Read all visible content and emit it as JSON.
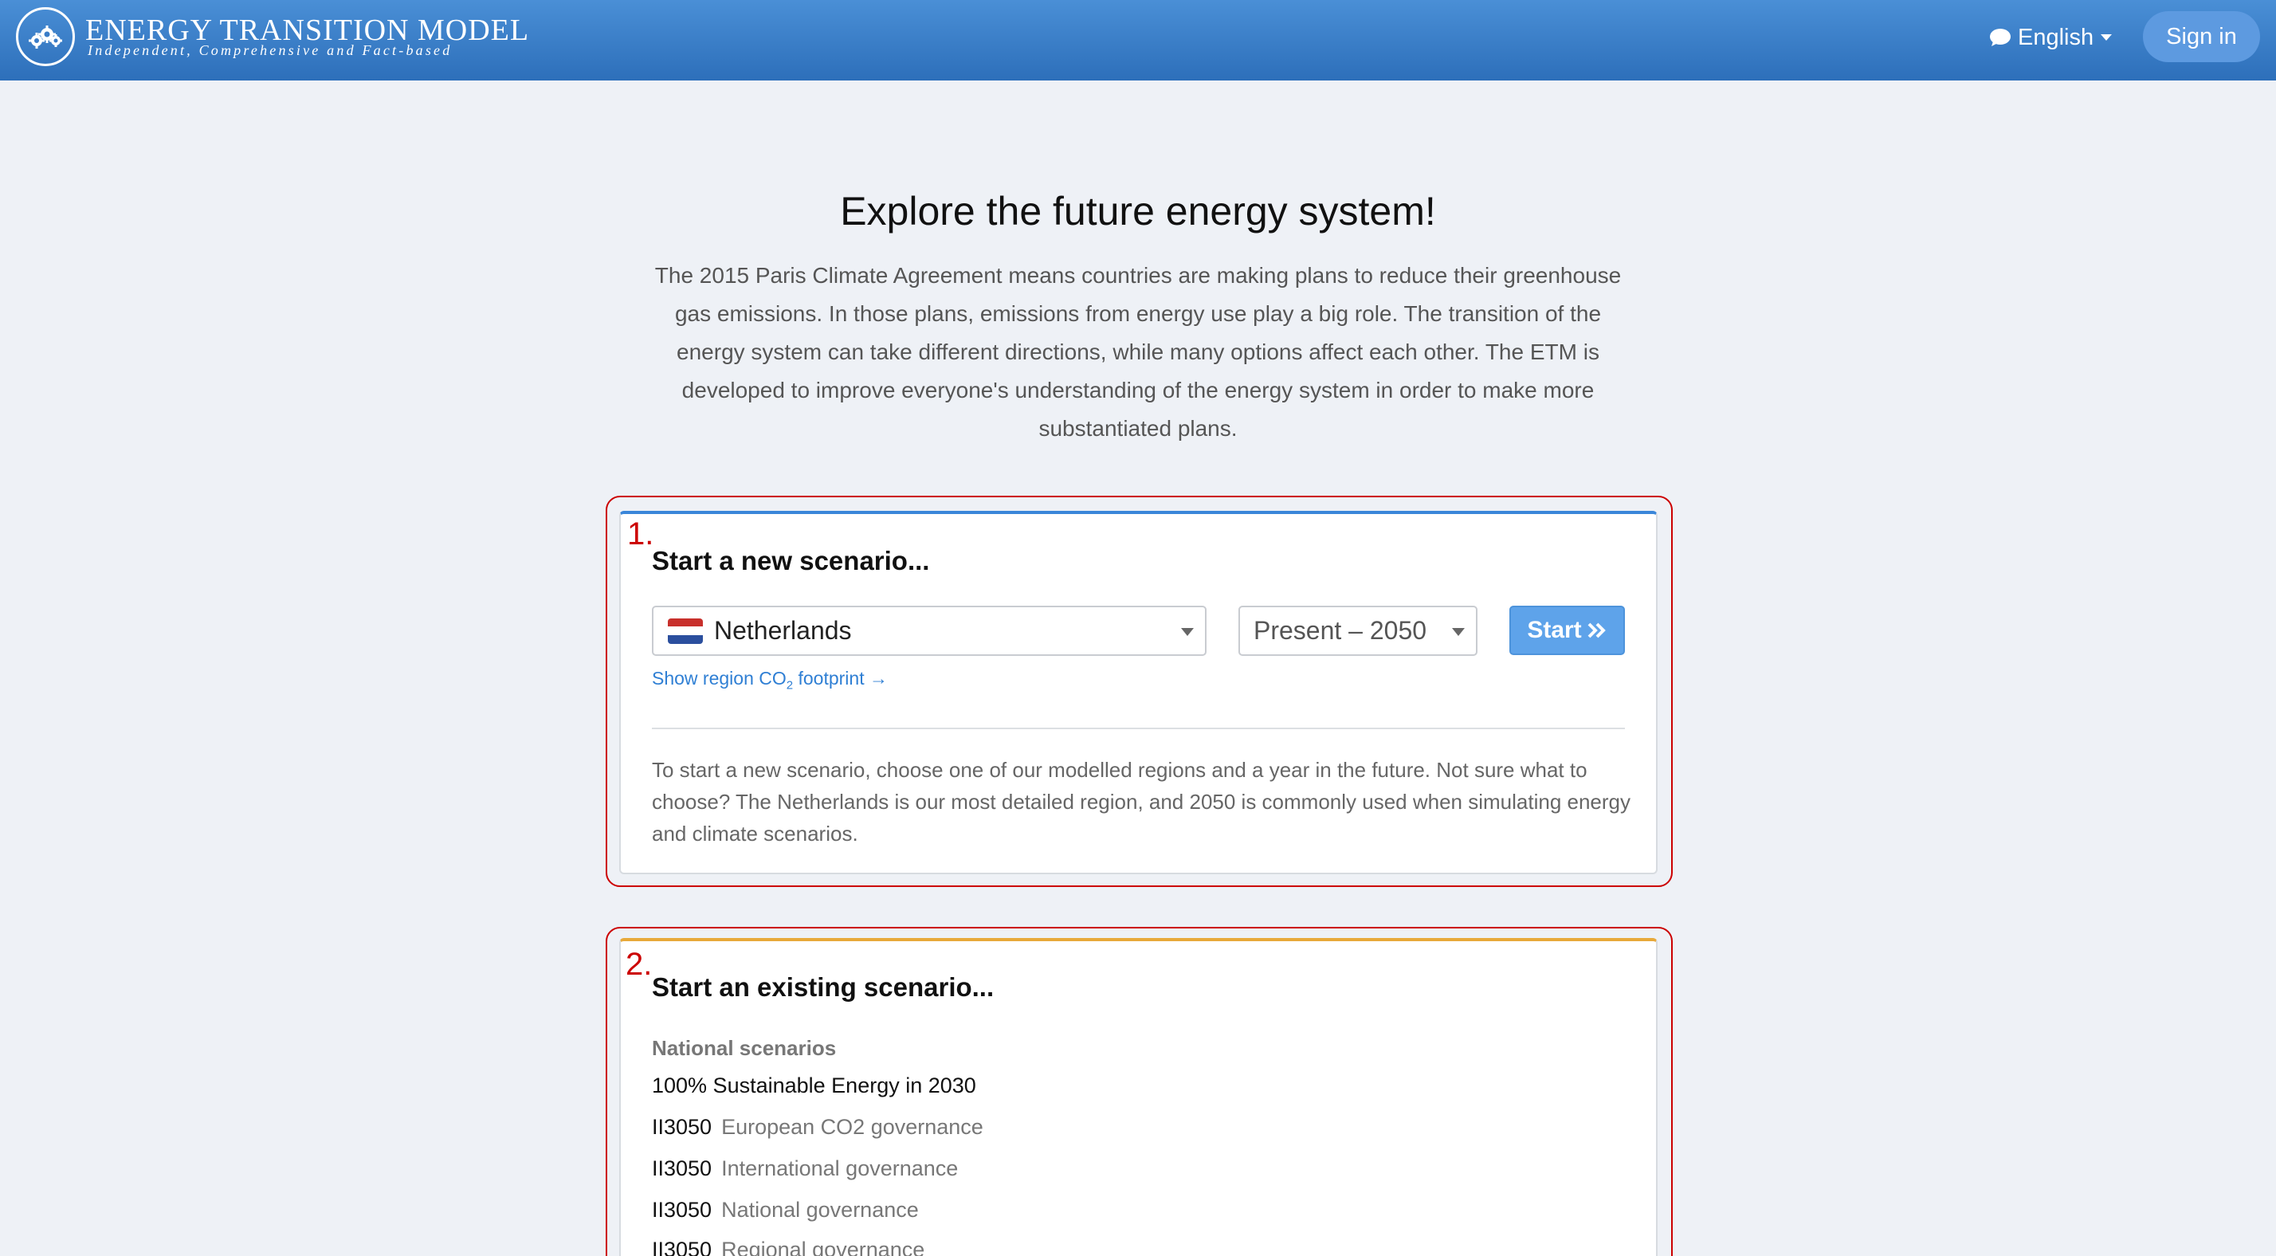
{
  "header": {
    "title": "ENERGY TRANSITION MODEL",
    "tagline": "Independent, Comprehensive and Fact-based",
    "language": "English",
    "sign_in": "Sign in"
  },
  "intro": {
    "title": "Explore the future energy system!",
    "text": "The 2015 Paris Climate Agreement means countries are making plans to reduce their greenhouse gas emissions. In those plans, emissions from energy use play a big role. The transition of the energy system can take different directions, while many options affect each other. The ETM is developed to improve everyone's understanding of the energy system in order to make more substantiated plans."
  },
  "new_scenario": {
    "number": "1.",
    "title": "Start a new scenario...",
    "region": "Netherlands",
    "year": "Present – 2050",
    "start_label": "Start",
    "co2_link_prefix": "Show region CO",
    "co2_link_sub": "2",
    "co2_link_suffix": " footprint →",
    "description": "To start a new scenario, choose one of our modelled regions and a year in the future. Not sure what to choose? The Netherlands is our most detailed region, and 2050 is commonly used when simulating energy and climate scenarios."
  },
  "existing_scenario": {
    "number": "2.",
    "title": "Start an existing scenario...",
    "section_label": "National scenarios",
    "items": [
      {
        "name": "100% Sustainable Energy in 2030",
        "sub": ""
      },
      {
        "name": "II3050",
        "sub": "European CO2 governance"
      },
      {
        "name": "II3050",
        "sub": "International governance"
      },
      {
        "name": "II3050",
        "sub": "National governance"
      },
      {
        "name": "II3050",
        "sub": "Regional governance"
      }
    ]
  },
  "colors": {
    "header": "#2d6fba",
    "accent_blue": "#3a86d9",
    "accent_orange": "#e8a93a",
    "annotation_red": "#cc0000"
  }
}
